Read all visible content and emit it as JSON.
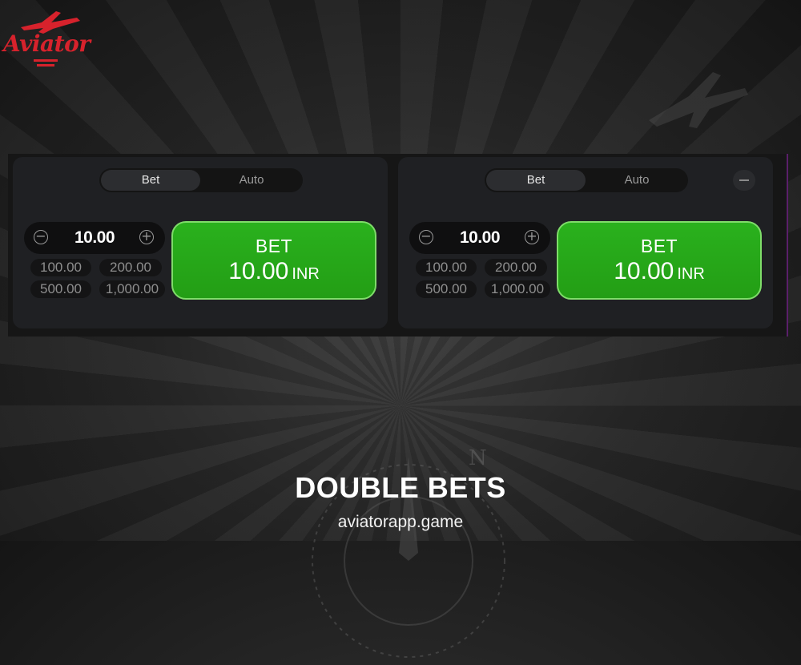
{
  "brand": {
    "logo_text": "Aviator",
    "brand_color": "#d7222c"
  },
  "panels": [
    {
      "tabs": {
        "active": "Bet",
        "inactive": "Auto"
      },
      "stepper": {
        "amount": "10.00",
        "minus_icon": "minus-circle-icon",
        "plus_icon": "plus-circle-icon"
      },
      "quick_amounts": [
        "100.00",
        "200.00",
        "500.00",
        "1,000.00"
      ],
      "bet_button": {
        "title": "BET",
        "amount": "10.00",
        "currency": "INR",
        "color": "#2ab11d"
      }
    },
    {
      "tabs": {
        "active": "Bet",
        "inactive": "Auto"
      },
      "stepper": {
        "amount": "10.00",
        "minus_icon": "minus-circle-icon",
        "plus_icon": "plus-circle-icon"
      },
      "quick_amounts": [
        "100.00",
        "200.00",
        "500.00",
        "1,000.00"
      ],
      "bet_button": {
        "title": "BET",
        "amount": "10.00",
        "currency": "INR",
        "color": "#2ab11d"
      },
      "collapse_icon": "collapse-panel-icon"
    }
  ],
  "caption": {
    "headline": "DOUBLE BETS",
    "site": "aviatorapp.game"
  }
}
